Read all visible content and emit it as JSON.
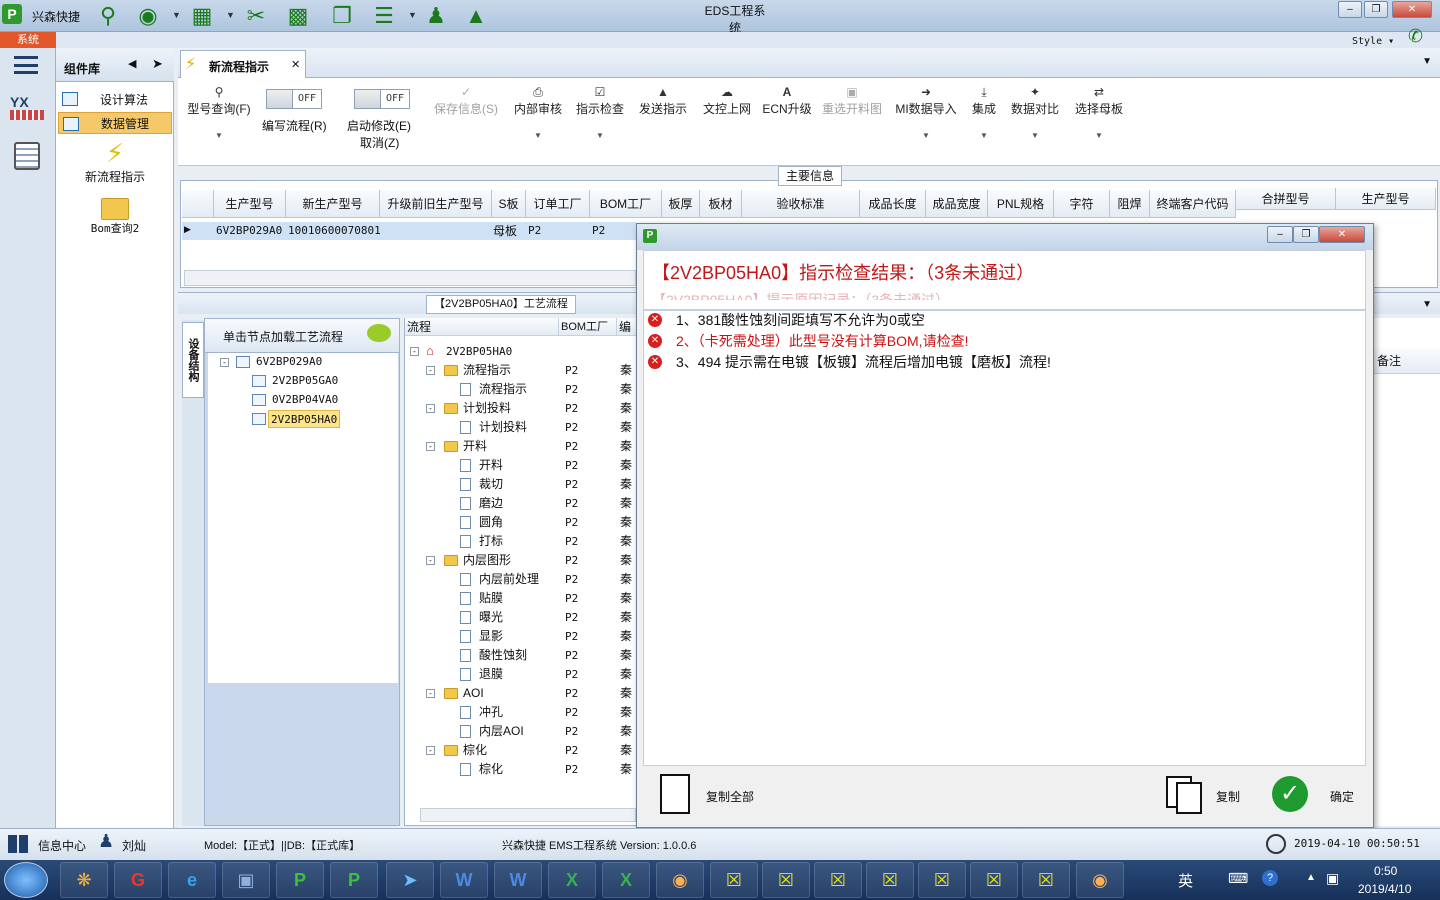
{
  "app": {
    "title": "EDS工程系统",
    "brand": "兴森快捷",
    "system_tab": "系统",
    "style_label": "Style",
    "accent": "#1b7a1b"
  },
  "sidebar": {
    "header": "组件库",
    "items": [
      {
        "label": "设计算法"
      },
      {
        "label": "数据管理"
      },
      {
        "label": "新流程指示"
      },
      {
        "label": "Bom查询2"
      }
    ]
  },
  "tab": {
    "label": "新流程指示"
  },
  "toolbar": {
    "query": "型号查询(F)",
    "write_toggle": "OFF",
    "write": "编写流程(R)",
    "edit_toggle": "OFF",
    "edit": "启动修改(E)",
    "cancel": "取消(Z)",
    "save": "保存信息(S)",
    "review": "内部审核",
    "check": "指示检查",
    "send": "发送指示",
    "upload": "文控上网",
    "ecn": "ECN升级",
    "reselect": "重选开料图",
    "mi_import": "MI数据导入",
    "integrate": "集成",
    "compare": "数据对比",
    "select_board": "选择母板"
  },
  "main_info": {
    "label": "主要信息",
    "columns": [
      "生产型号",
      "新生产型号",
      "升级前旧生产型号",
      "S板",
      "订单工厂",
      "BOM工厂",
      "板厚",
      "板材",
      "验收标准",
      "成品长度",
      "成品宽度",
      "PNL规格",
      "字符",
      "阻焊",
      "终端客户代码",
      "合拼型号",
      "生产型号"
    ],
    "row": {
      "model": "6V2BP029A0",
      "new_model": "10010600070801",
      "sboard": "母板",
      "order_factory": "P2",
      "bom_factory": "P2"
    }
  },
  "process": {
    "label": "【2V2BP05HA0】工艺流程",
    "device_tab": "设备结构",
    "device_hint": "单击节点加载工艺流程",
    "device_tree": [
      "6V2BP029A0",
      "2V2BP05GA0",
      "0V2BP04VA0",
      "2V2BP05HA0"
    ],
    "columns": {
      "flow": "流程",
      "bom": "BOM工厂",
      "extra": "编"
    },
    "root": "2V2BP05HA0",
    "factory": "P2",
    "extra_char": "秦",
    "rows": [
      "流程指示",
      "流程指示",
      "计划投料",
      "计划投料",
      "开料",
      "开料",
      "裁切",
      "磨边",
      "圆角",
      "打标",
      "内层图形",
      "内层前处理",
      "贴膜",
      "曝光",
      "显影",
      "酸性蚀刻",
      "退膜",
      "AOI",
      "冲孔",
      "内层AOI",
      "棕化",
      "棕化"
    ],
    "right_col": "备注"
  },
  "dialog": {
    "heading": "【2V2BP05HA0】指示检查结果：（3条未通过）",
    "heading_shadow": "【2V2BP05HA0】提示原因记录：（3条未通过）",
    "messages": [
      {
        "text": "1、381酸性蚀刻间距填写不允许为0或空",
        "color": "#111111"
      },
      {
        "text": "2、（卡死需处理）此型号没有计算BOM,请检查!",
        "color": "#d01010"
      },
      {
        "text": "3、494 提示需在电镀【板镀】流程后增加电镀【磨板】流程!",
        "color": "#111111"
      }
    ],
    "copy_all": "复制全部",
    "copy": "复制",
    "ok": "确定"
  },
  "status": {
    "info_center": "信息中心",
    "user": "刘灿",
    "model_db": "Model:【正式】||DB:【正式库】",
    "version": "兴森快捷 EMS工程系统 Version: 1.0.0.6",
    "datetime": "2019-04-10 00:50:51"
  },
  "taskbar": {
    "time": "0:50",
    "date": "2019/4/10",
    "ime": "英"
  }
}
